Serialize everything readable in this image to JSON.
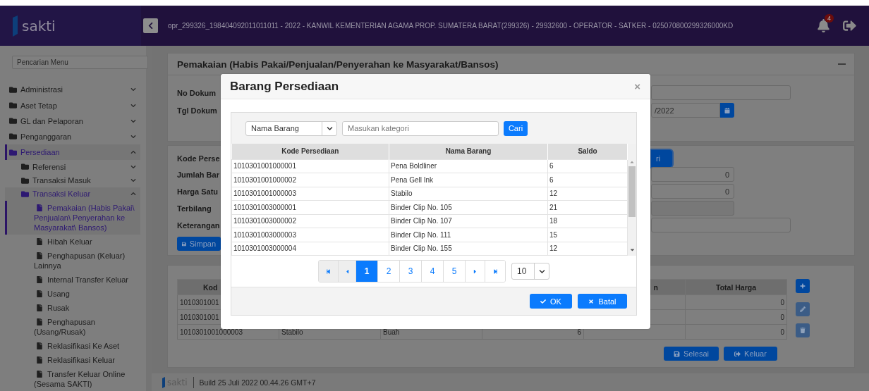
{
  "header": {
    "logo": "sakti",
    "user_info": "opr_299326_198404092011011011 - 2022 - KANWIL KEMENTERIAN AGAMA PROP. SUMATERA BARAT(299326) - 29932600 - OPERATOR - SATKER - 025070800299326000KD",
    "notification_count": "4"
  },
  "sidebar": {
    "search_placeholder": "Pencarian Menu",
    "items": [
      {
        "label": "Administrasi",
        "kind": "folder",
        "expanded": false,
        "selected": false
      },
      {
        "label": "Aset Tetap",
        "kind": "folder",
        "expanded": false,
        "selected": false
      },
      {
        "label": "GL dan Pelaporan",
        "kind": "folder",
        "expanded": false,
        "selected": false
      },
      {
        "label": "Penganggaran",
        "kind": "folder",
        "expanded": false,
        "selected": false
      },
      {
        "label": "Persediaan",
        "kind": "folder",
        "expanded": true,
        "selected": true,
        "children": [
          {
            "label": "Referensi",
            "kind": "folder",
            "expanded": false,
            "selected": false
          },
          {
            "label": "Transaksi Masuk",
            "kind": "folder",
            "expanded": false,
            "selected": false
          },
          {
            "label": "Transaksi Keluar",
            "kind": "folder",
            "expanded": true,
            "selected": true,
            "children": [
              {
                "label": "Pemakaian (Habis Pakai\\ Penjualan\\ Penyerahan ke Masyarakat\\ Bansos)",
                "kind": "page",
                "selected": true
              },
              {
                "label": "Hibah Keluar",
                "kind": "page",
                "selected": false
              },
              {
                "label": "Penghapusan (Keluar) Lainnya",
                "kind": "page",
                "selected": false
              },
              {
                "label": "Internal Transfer Keluar",
                "kind": "page",
                "selected": false
              },
              {
                "label": "Usang",
                "kind": "page",
                "selected": false
              },
              {
                "label": "Rusak",
                "kind": "page",
                "selected": false
              },
              {
                "label": "Penghapusan (Usang/Rusak)",
                "kind": "page",
                "selected": false
              },
              {
                "label": "Reklasifikasi Ke Aset",
                "kind": "page",
                "selected": false
              },
              {
                "label": "Reklasifikasi Keluar",
                "kind": "page",
                "selected": false
              },
              {
                "label": "Transfer Keluar Online (Sesama SAKTI)",
                "kind": "page",
                "selected": false
              }
            ]
          }
        ]
      }
    ]
  },
  "page": {
    "title": "Pemakaian (Habis Pakai/Penjualan/Penyerahan ke Masyarakat/Bansos)",
    "document_fields": [
      {
        "label": "No Dokum",
        "kind": "text"
      },
      {
        "label": "Tgl Dokum",
        "kind": "date",
        "value": "/2022"
      }
    ],
    "item_fields": [
      {
        "label": "Kode Perse",
        "kind": "button",
        "value": "ri"
      },
      {
        "label": "Jumlah Bar",
        "kind": "number",
        "value": "0"
      },
      {
        "label": "Harga Satu",
        "kind": "number",
        "value": "0"
      },
      {
        "label": "Terbilang",
        "kind": "readonly"
      },
      {
        "label": "Keterangan",
        "kind": "text"
      }
    ],
    "save_button": "Simpan",
    "table": {
      "columns": {
        "column_1": "Kod",
        "column_5": "n",
        "column_6": "Total Harga"
      },
      "rows": [
        {
          "column_1": "1010301001",
          "column_6": "0"
        },
        {
          "column_1": "1010301001",
          "column_6": "0"
        },
        {
          "column_1": "1010301001000003",
          "column_2": "Stabilo",
          "column_3": "Buah",
          "column_4": "6",
          "column_6": "0"
        }
      ]
    },
    "actions": [
      "Selesai",
      "Keluar"
    ]
  },
  "footer": {
    "logo": "sakti",
    "build": "Build 25 Juli 2022 00.44.26 GMT+7"
  },
  "modal": {
    "title": "Barang Persediaan",
    "close": "×",
    "search": {
      "field": "Nama Barang",
      "placeholder": "Masukan kategori",
      "button": "Cari"
    },
    "columns": [
      "Kode Persediaan",
      "Nama Barang",
      "Saldo"
    ],
    "rows": [
      [
        "1010301001000001",
        "Pena Boldliner",
        "6"
      ],
      [
        "1010301001000002",
        "Pena Gell Ink",
        "6"
      ],
      [
        "1010301001000003",
        "Stabilo",
        "12"
      ],
      [
        "1010301003000001",
        "Binder Clip No. 105",
        "21"
      ],
      [
        "1010301003000002",
        "Binder Clip No. 107",
        "18"
      ],
      [
        "1010301003000003",
        "Binder Clip No. 111",
        "15"
      ],
      [
        "1010301003000004",
        "Binder Clip No. 155",
        "12"
      ]
    ],
    "pages": [
      {
        "label": "1",
        "selected": true
      },
      {
        "label": "2",
        "selected": false
      },
      {
        "label": "3",
        "selected": false
      },
      {
        "label": "4",
        "selected": false
      },
      {
        "label": "5",
        "selected": false
      }
    ],
    "page_size": "10",
    "buttons": [
      "OK",
      "Batal"
    ]
  }
}
